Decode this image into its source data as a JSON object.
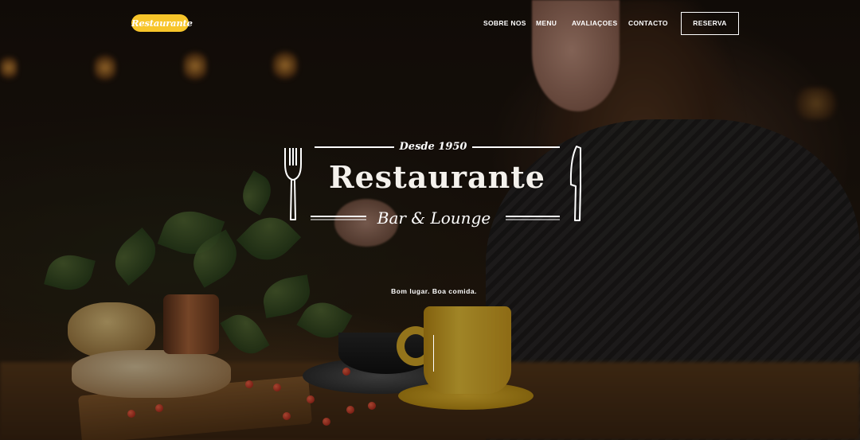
{
  "header": {
    "logo_text": "Restaurante",
    "nav": [
      "SOBRE NOS",
      "MENU",
      "AVALIAÇOES",
      "CONTACTO"
    ],
    "reserve_label": "RESERVA"
  },
  "hero": {
    "since": "Desde 1950",
    "brand": "Restaurante",
    "subtitle": "Bar & Lounge",
    "tagline": "Bom lugar. Boa comida."
  },
  "colors": {
    "accent": "#f7c52a",
    "text": "#ffffff"
  },
  "icons": {
    "left": "fork-icon",
    "right": "knife-icon"
  }
}
